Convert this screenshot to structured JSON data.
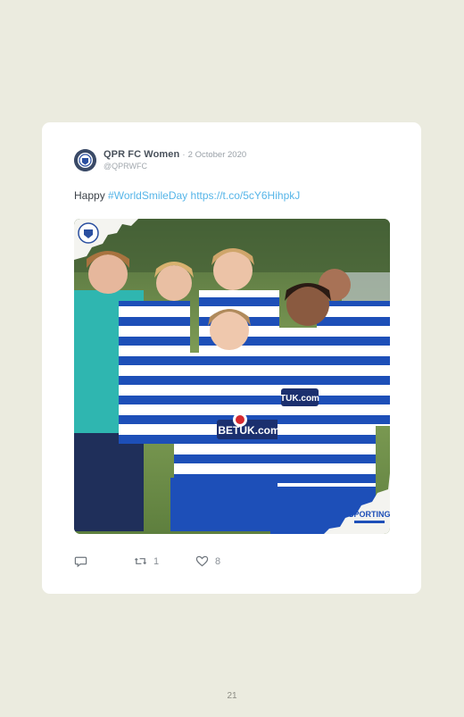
{
  "tweet": {
    "display_name": "QPR FC Women",
    "separator": "·",
    "date": "2 October 2020",
    "handle": "@QPRWFC",
    "text_prefix": "Happy ",
    "hashtag": "#WorldSmileDay",
    "link": "https://t.co/5cY6HihpkJ",
    "media_alt_icon": "photo-of-players-smiling",
    "media_sponsor_text": "SPORTING",
    "actions": {
      "reply_icon": "reply-icon",
      "retweet_icon": "retweet-icon",
      "retweet_count": "1",
      "like_icon": "heart-icon",
      "like_count": "8"
    }
  },
  "page": {
    "number": "21"
  },
  "colors": {
    "background": "#ebebdf",
    "card": "#ffffff",
    "link": "#56b5e8",
    "kit_blue": "#1d4fb8"
  }
}
